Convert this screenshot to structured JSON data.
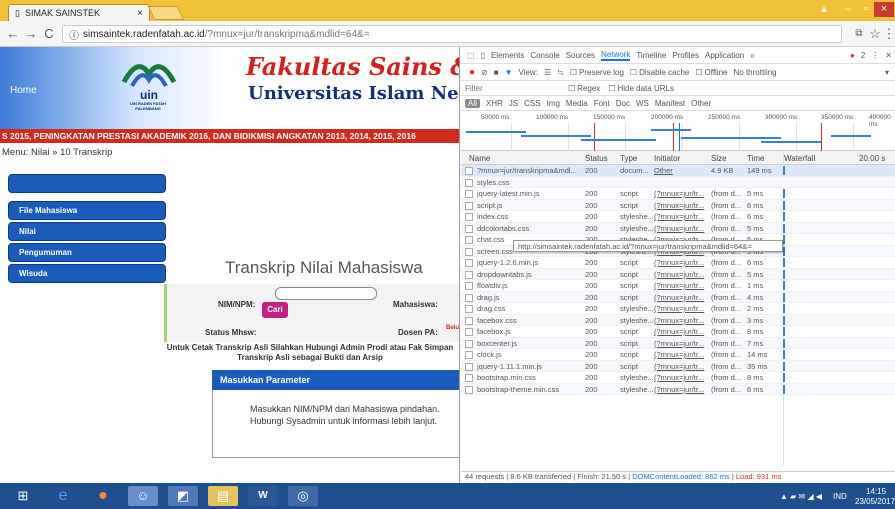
{
  "browser": {
    "tab_title": "SIMAK SAINSTEK",
    "tab_close": "×",
    "url_domain": "simsaintek.radenfatah.ac.id",
    "url_path": "/?mnux=jur/transkripma&mdlid=64&=",
    "back": "←",
    "forward": "→",
    "reload": "C",
    "info": "ⓘ"
  },
  "window": {
    "minimize": "–",
    "maximize": "▫",
    "close": "×"
  },
  "site": {
    "home": "Home",
    "logo_text": "UIN RADEN FATAH PALEMBANG",
    "faculty": "Fakultas Sains & T",
    "university": "Universitas Islam Negeri Rad",
    "marquee": "S 2015, PENINGKATAN PRESTASI AKADEMIK 2016, DAN BIDIKMISI ANGKATAN 2013, 2014, 2015, 2016",
    "breadcrumb": "Menu: Nilai » 10 Transkrip"
  },
  "sidebar": {
    "items": [
      {
        "label": ""
      },
      {
        "label": "File Mahasiswa"
      },
      {
        "label": "Nilai"
      },
      {
        "label": "Pengumuman"
      },
      {
        "label": "Wisuda"
      }
    ]
  },
  "main": {
    "title": "Transkrip Nilai Mahasiswa",
    "nim_label": "NIM/NPM:",
    "nim_value": "",
    "cari": "Cari",
    "mahasiswa_label": "Mahasiswa:",
    "status_label": "Status Mhsw:",
    "dosen_label": "Dosen PA:",
    "dosen_value": "Belu",
    "note": "Untuk Cetak Transkrip Asli Silahkan Hubungi Admin Prodi atau Fak Simpan Transkrip Asli sebagai Bukti dan Arsip",
    "param_header": "Masukkan Parameter",
    "param_text": "Masukkan NIM/NPM dari Mahasiswa pindahan. Hubungi Sysadmin untuk informasi lebih lanjut."
  },
  "devtools": {
    "tabs": [
      "Elements",
      "Console",
      "Sources",
      "Network",
      "Timeline",
      "Profiles",
      "Application",
      "»"
    ],
    "active_tab": "Network",
    "error_count": "2",
    "toolbar": {
      "view": "View:",
      "preserve": "Preserve log",
      "disable_cache": "Disable cache",
      "offline": "Offline",
      "throttle": "No throttling"
    },
    "filter": {
      "placeholder": "Filter",
      "regex": "Regex",
      "hide_data": "Hide data URLs"
    },
    "types": [
      "All",
      "XHR",
      "JS",
      "CSS",
      "Img",
      "Media",
      "Font",
      "Doc",
      "WS",
      "Manifest",
      "Other"
    ],
    "timeline_ticks": [
      "50000 ms",
      "100000 ms",
      "150000 ms",
      "200000 ms",
      "250000 ms",
      "300000 ms",
      "350000 ms",
      "400000 ms"
    ],
    "columns": {
      "name": "Name",
      "status": "Status",
      "type": "Type",
      "initiator": "Initiator",
      "size": "Size",
      "time": "Time",
      "waterfall": "Waterfall",
      "wf_time": "20.00 s"
    },
    "rows": [
      {
        "name": "?mnux=jur/transkripma&mdl...",
        "status": "200",
        "type": "docum...",
        "initiator": "Other",
        "size": "4.9 KB",
        "time": "149 ms"
      },
      {
        "name": "styles.css",
        "status": "",
        "type": "",
        "initiator": "",
        "size": "",
        "time": ""
      },
      {
        "name": "jquery-latest.min.js",
        "status": "200",
        "type": "script",
        "initiator": "(?mnux=jur/tr...",
        "size": "(from d...",
        "time": "5 ms"
      },
      {
        "name": "script.js",
        "status": "200",
        "type": "script",
        "initiator": "(?mnux=jur/tr...",
        "size": "(from d...",
        "time": "6 ms"
      },
      {
        "name": "index.css",
        "status": "200",
        "type": "styleshe...",
        "initiator": "(?mnux=jur/tr...",
        "size": "(from d...",
        "time": "6 ms"
      },
      {
        "name": "ddcolortabs.css",
        "status": "200",
        "type": "styleshe...",
        "initiator": "(?mnux=jur/tr...",
        "size": "(from d...",
        "time": "5 ms"
      },
      {
        "name": "chat.css",
        "status": "200",
        "type": "styleshe...",
        "initiator": "(?mnux=jur/tr...",
        "size": "(from d...",
        "time": "5 ms"
      },
      {
        "name": "screen.css",
        "status": "200",
        "type": "styleshe...",
        "initiator": "(?mnux=jur/tr...",
        "size": "(from d...",
        "time": "5 ms"
      },
      {
        "name": "jquery-1.2.6.min.js",
        "status": "200",
        "type": "script",
        "initiator": "(?mnux=jur/tr...",
        "size": "(from d...",
        "time": "6 ms"
      },
      {
        "name": "dropdowntabs.js",
        "status": "200",
        "type": "script",
        "initiator": "(?mnux=jur/tr...",
        "size": "(from d...",
        "time": "5 ms"
      },
      {
        "name": "floatdiv.js",
        "status": "200",
        "type": "script",
        "initiator": "(?mnux=jur/tr...",
        "size": "(from d...",
        "time": "1 ms"
      },
      {
        "name": "drag.js",
        "status": "200",
        "type": "script",
        "initiator": "(?mnux=jur/tr...",
        "size": "(from d...",
        "time": "4 ms"
      },
      {
        "name": "drag.css",
        "status": "200",
        "type": "styleshe...",
        "initiator": "(?mnux=jur/tr...",
        "size": "(from d...",
        "time": "2 ms"
      },
      {
        "name": "facebox.css",
        "status": "200",
        "type": "styleshe...",
        "initiator": "(?mnux=jur/tr...",
        "size": "(from d...",
        "time": "3 ms"
      },
      {
        "name": "facebox.js",
        "status": "200",
        "type": "script",
        "initiator": "(?mnux=jur/tr...",
        "size": "(from d...",
        "time": "8 ms"
      },
      {
        "name": "boxcenter.js",
        "status": "200",
        "type": "script",
        "initiator": "(?mnux=jur/tr...",
        "size": "(from d...",
        "time": "7 ms"
      },
      {
        "name": "clock.js",
        "status": "200",
        "type": "script",
        "initiator": "(?mnux=jur/tr...",
        "size": "(from d...",
        "time": "14 ms"
      },
      {
        "name": "jquery-1.11.1.min.js",
        "status": "200",
        "type": "script",
        "initiator": "(?mnux=jur/tr...",
        "size": "(from d...",
        "time": "35 ms"
      },
      {
        "name": "bootstrap.min.css",
        "status": "200",
        "type": "styleshe...",
        "initiator": "(?mnux=jur/tr...",
        "size": "(from d...",
        "time": "8 ms"
      },
      {
        "name": "bootstrap-theme.min.css",
        "status": "200",
        "type": "styleshe...",
        "initiator": "(?mnux=jur/tr...",
        "size": "(from d...",
        "time": "6 ms"
      }
    ],
    "tooltip": "http://simsaintek.radenfatah.ac.id/?mnux=jur/transkripma&mdlid=64&=",
    "status": {
      "summary": "44 requests | 8.6 KB transferred | Finish: 21.50 s | ",
      "dom": "DOMContentLoaded: 862 ms",
      "sep": " | ",
      "load": "Load: 931 ms"
    }
  },
  "taskbar": {
    "lang": "IND",
    "time": "14:15",
    "date": "23/05/2017"
  },
  "colors": {
    "titlebar": "#f2c13a",
    "header_red": "#d22a1d",
    "menu_blue": "#1a5cbb",
    "cari": "#c2207f",
    "taskbar": "#1f4f8c"
  }
}
